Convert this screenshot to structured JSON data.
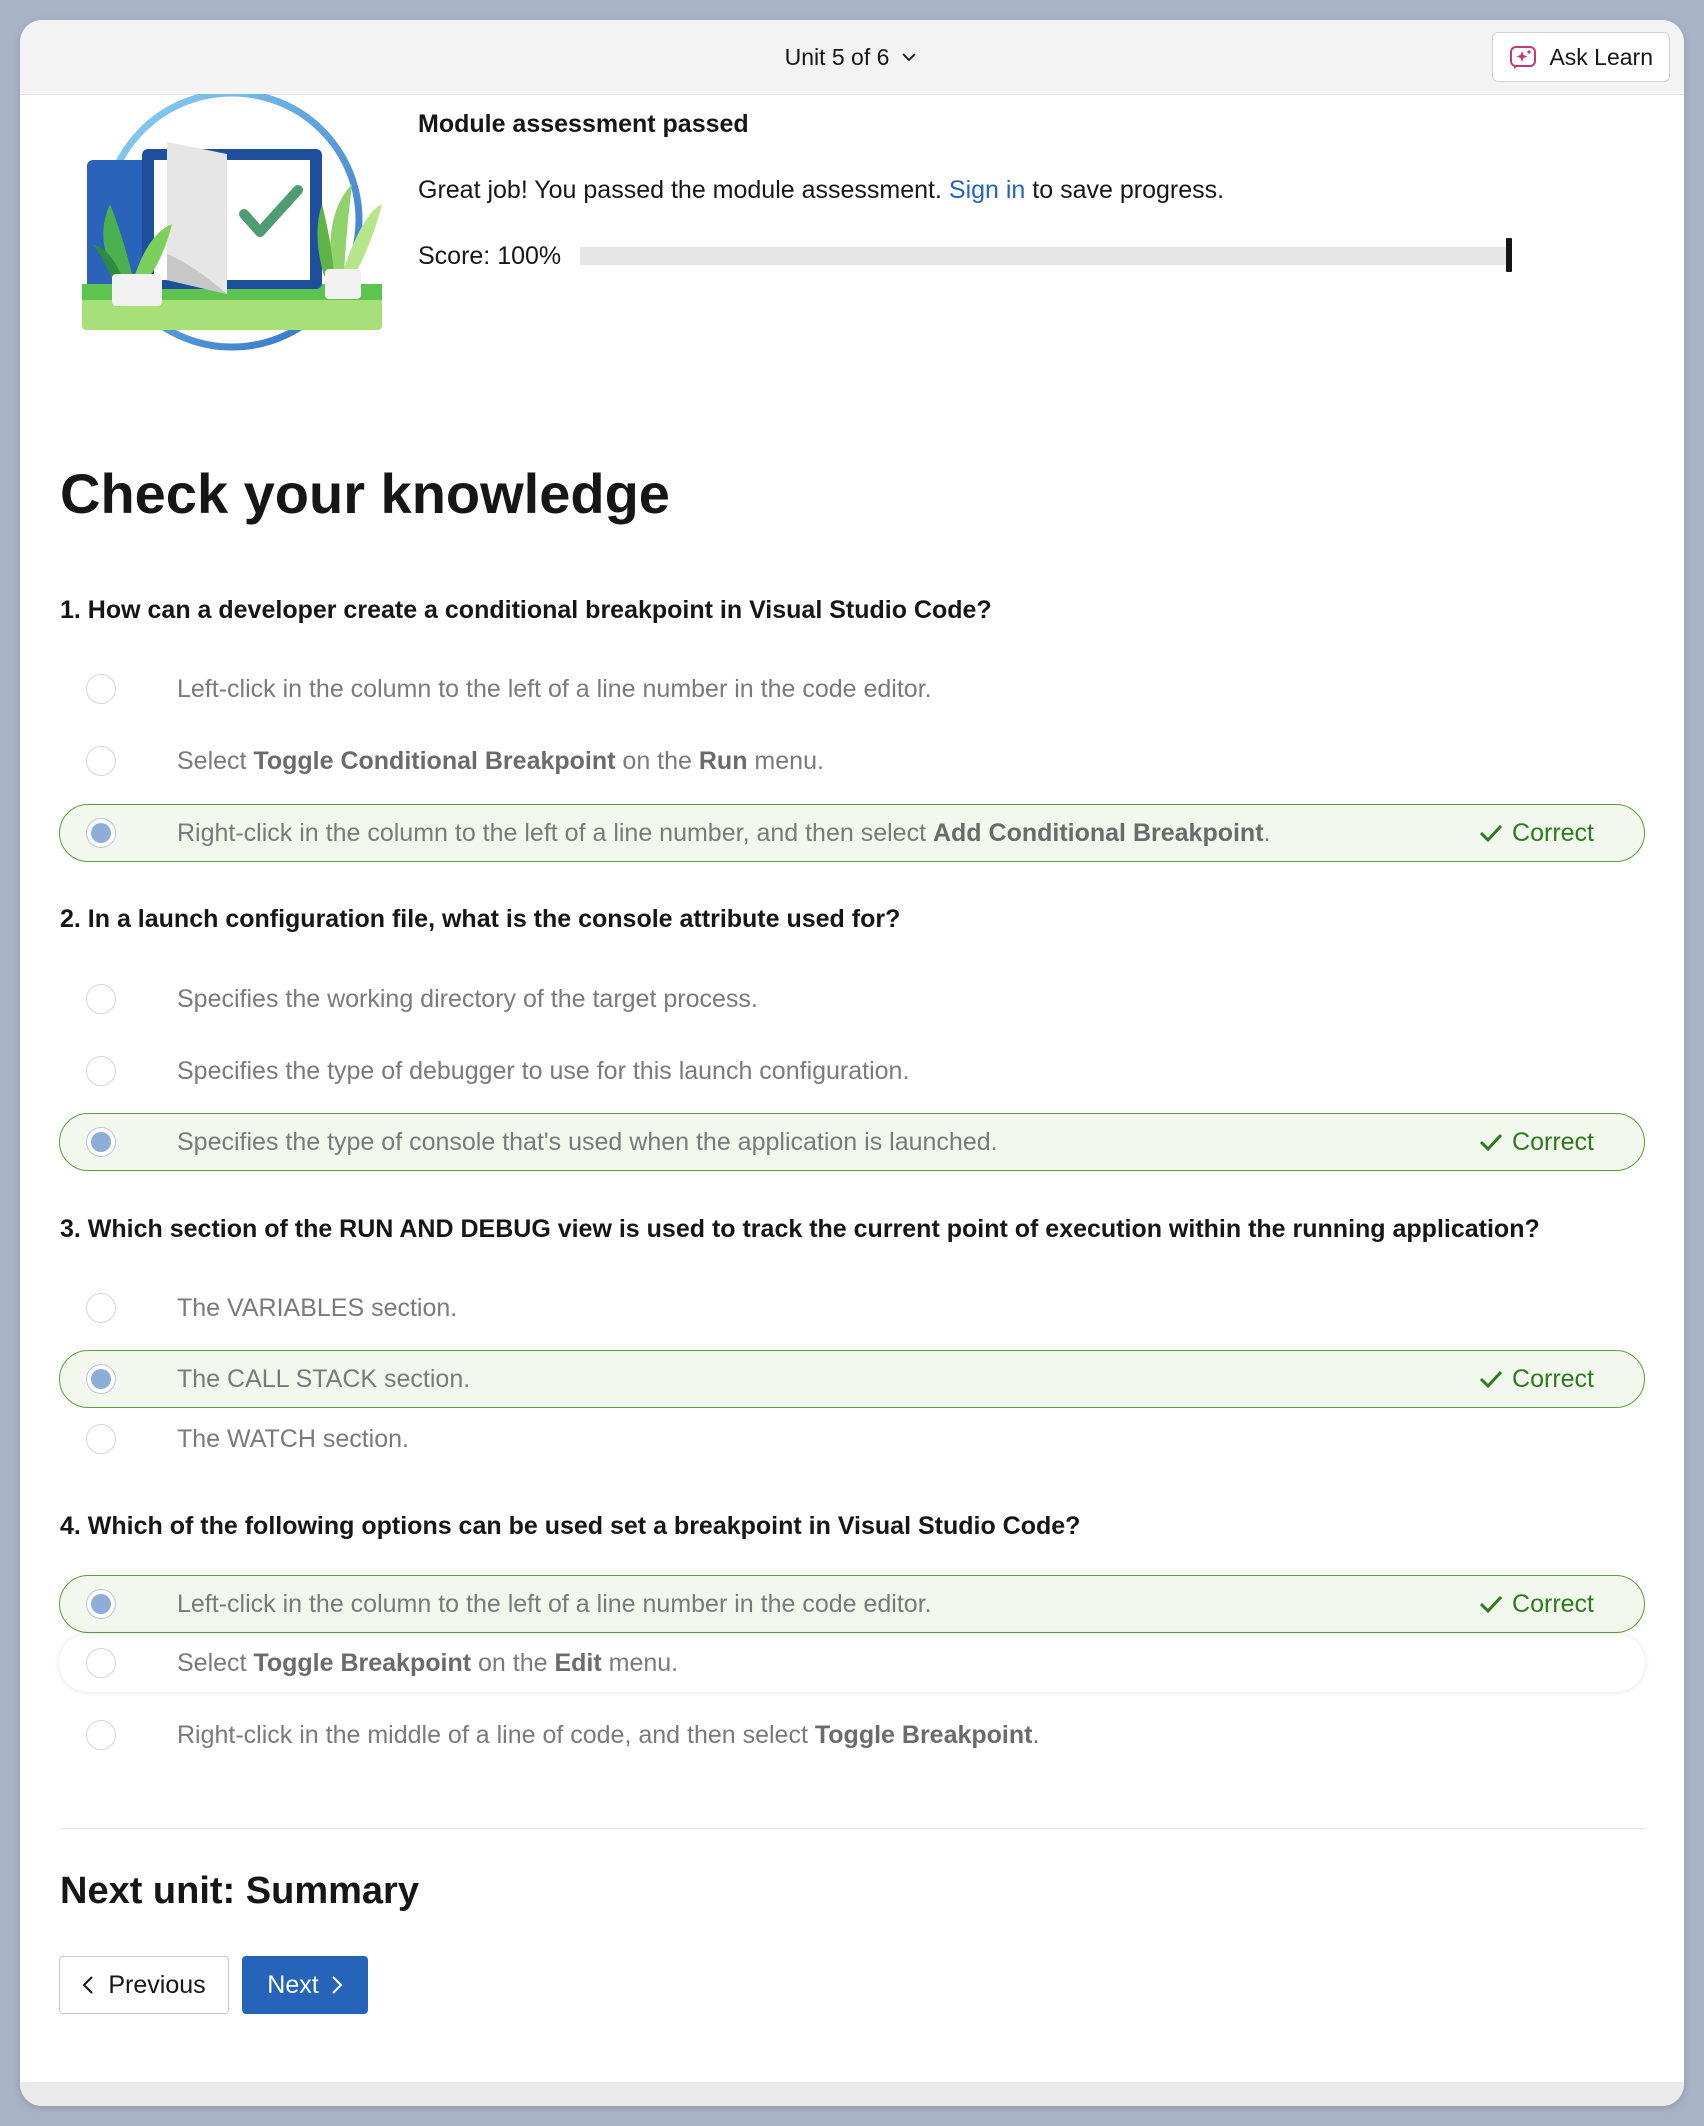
{
  "header": {
    "unit_label": "Unit 5 of 6",
    "ask_learn_label": "Ask Learn"
  },
  "assessment": {
    "title": "Module assessment passed",
    "message_before": "Great job! You passed the module assessment. ",
    "sign_in_link": "Sign in",
    "message_after": " to save progress.",
    "score_label": "Score: 100%",
    "score_fraction": 1.0
  },
  "section_title": "Check your knowledge",
  "questions": [
    {
      "text": "1. How can a developer create a conditional breakpoint in Visual Studio Code?",
      "options": [
        {
          "parts": [
            "Left-click in the column to the left of a line number in the code editor."
          ]
        },
        {
          "parts": [
            "Select ",
            "Toggle Conditional Breakpoint",
            " on the ",
            "Run",
            " menu."
          ]
        },
        {
          "parts": [
            "Right-click in the column to the left of a line number, and then select ",
            "Add Conditional Breakpoint",
            "."
          ]
        }
      ]
    },
    {
      "text": "2. In a launch configuration file, what is the console attribute used for?",
      "options": [
        {
          "parts": [
            "Specifies the working directory of the target process."
          ]
        },
        {
          "parts": [
            "Specifies the type of debugger to use for this launch configuration."
          ]
        },
        {
          "parts": [
            "Specifies the type of console that's used when the application is launched."
          ]
        }
      ]
    },
    {
      "text": "3. Which section of the RUN AND DEBUG view is used to track the current point of execution within the running application?",
      "options": [
        {
          "parts": [
            "The VARIABLES section."
          ]
        },
        {
          "parts": [
            "The CALL STACK section."
          ]
        },
        {
          "parts": [
            "The WATCH section."
          ]
        }
      ]
    },
    {
      "text": "4. Which of the following options can be used set a breakpoint in Visual Studio Code?",
      "options": [
        {
          "parts": [
            "Left-click in the column to the left of a line number in the code editor."
          ]
        },
        {
          "parts": [
            "Select ",
            "Toggle Breakpoint",
            " on the ",
            "Edit",
            " menu."
          ]
        },
        {
          "parts": [
            "Right-click in the middle of a line of code, and then select ",
            "Toggle Breakpoint",
            "."
          ]
        }
      ]
    }
  ],
  "correct_label": "Correct",
  "next_unit_title": "Next unit: Summary",
  "nav": {
    "previous_label": "Previous",
    "next_label": "Next"
  },
  "colors": {
    "accent": "#2564b8",
    "correct_green": "#2f7a1f",
    "correct_bg": "#f2f8ee"
  }
}
